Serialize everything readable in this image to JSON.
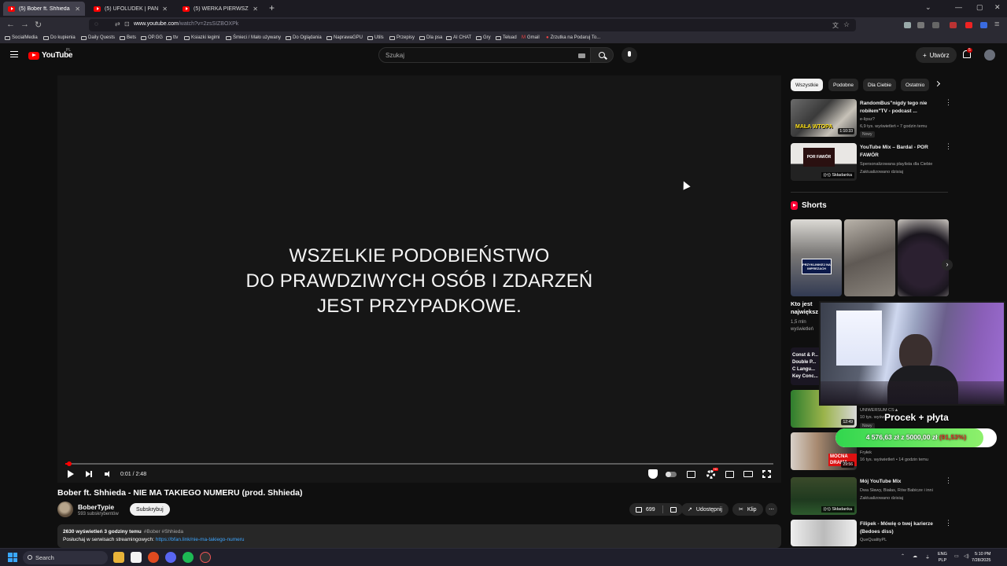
{
  "browser": {
    "tabs": [
      {
        "label": "(5) Bober ft. Shhieda - NIE MA",
        "active": true
      },
      {
        "label": "(5) UFOLUDEK | PAN POLICJANT",
        "active": false
      },
      {
        "label": "(5) WERKA PIERWSZY STREAM",
        "active": false
      }
    ],
    "url_domain": "www.youtube.com",
    "url_path": "/watch?v=2zsSIZBOXPk",
    "bookmarks": [
      "SocialMedia",
      "Do kupienia",
      "Daily Quests",
      "Bets",
      "OP.GG",
      "ttv",
      "Ksiazki legimi",
      "Śmieci / Mało używany",
      "Do Oglądania",
      "NaprawaGPU",
      "Utils",
      "Przepisy",
      "Dla psa",
      "AI CHAT",
      "Gry",
      "Tełuad",
      "Gmail",
      "Zrzutka na Podaruj To..."
    ]
  },
  "youtube_header": {
    "logo_text": "YouTube",
    "region": "PL",
    "search_placeholder": "Szukaj",
    "create_label": "Utwórz",
    "notification_count": "5"
  },
  "player": {
    "disclaimer_lines": [
      "WSZELKIE PODOBIEŃSTWO",
      "DO PRAWDZIWYCH OSÓB I ZDARZEŃ",
      "JEST PRZYPADKOWE."
    ],
    "time_current": "0:01",
    "time_total": "2:48",
    "progress_fraction": 0.006
  },
  "video": {
    "title": "Bober ft. Shhieda - NIE MA TAKIEGO NUMERU (prod. Shhieda)",
    "channel": "BoberTypie",
    "subscribers": "593 subskrybentów",
    "subscribe_label": "Subskrybuj",
    "likes": "699",
    "share_label": "Udostępnij",
    "clip_label": "Klip",
    "views_age": "2630 wyświetleń  3 godziny temu",
    "tags": "#Bober #Shhieda",
    "desc_prefix": "Posłuchaj w serwisach streamingowych:",
    "desc_link": "https://bfan.link/nie-ma-takiego-numeru"
  },
  "sidebar": {
    "chips": [
      {
        "label": "Wszystkie",
        "active": true
      },
      {
        "label": "Podobne",
        "active": false
      },
      {
        "label": "Dla Ciebie",
        "active": false
      },
      {
        "label": "Ostatnio",
        "active": false
      }
    ],
    "recs": [
      {
        "title": "RandomBus\"nigdy tego nie robiłem\"TV - podcast ...",
        "channel": "e-lipsz?",
        "meta": "6,9 tys. wyświetleń • 7 godzin temu",
        "badge": "Nowy",
        "duration": "1:10:33",
        "thumb_caption": "MAŁA WTOPA"
      },
      {
        "title": "YouTube Mix – Bardal - POR FAWÓR",
        "channel": "Spersonalizowana playlista dla Ciebie",
        "meta": "Zaktualizowano dzisiaj",
        "mix_label": "Składanka",
        "thumb_caption": "POR FAWÓR"
      }
    ],
    "shorts_label": "Shorts",
    "short_title_lines": [
      "Kto jest",
      "największ"
    ],
    "short_meta_lines": [
      "1,5 mln",
      "wyświetleń"
    ],
    "short_thumb_caption": "PRZYKLINIKEJ NA IMPREZACH",
    "recs_lower": [
      {
        "title": "Const & P... Double P... C Langu... Key Conc...",
        "channel": "",
        "meta": ""
      },
      {
        "title": "",
        "channel": "UNIWERSUM CS▲",
        "meta": "10 tys. wyświetleń",
        "badge": "Nowy",
        "duration": "12:49"
      },
      {
        "title": "",
        "channel": "Fryłek",
        "meta": "16 tys. wyświetleń • 14 godzin temu",
        "badge": "",
        "duration": "29:56",
        "thumb_caption": "MOCNA DRAMA"
      },
      {
        "title": "Mój YouTube Mix",
        "channel": "Dwa Sławy, Białas, Rów Babicze i inni",
        "meta": "Zaktualizowano dzisiaj",
        "mix_label": "Składanka"
      },
      {
        "title": "Filipek - Mówię o twej karierze (Bedoes diss)",
        "channel": "QueQualityPL",
        "meta": ""
      }
    ]
  },
  "overlay": {
    "goal_title": "Procek + płyta",
    "amount": "4 576,63 zł",
    "target": "z 5000,00 zł",
    "percent": "(91,53%)",
    "fraction": 0.9153
  },
  "taskbar": {
    "search_label": "Search",
    "lang_top": "ENG",
    "lang_bottom": "PLP",
    "time": "5:10 PM",
    "date": "7/28/2025"
  },
  "colors": {
    "background": "#0f0f0f",
    "accent_red": "#ff0000",
    "link_blue": "#3ea6ff",
    "goal_green": "#31d64e"
  }
}
